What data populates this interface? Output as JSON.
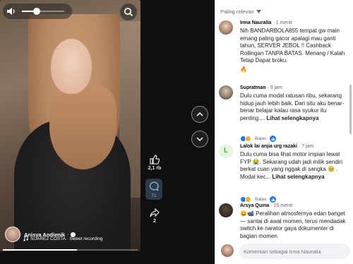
{
  "reel": {
    "author_name": "Anisya Andienik",
    "audio_label": "SUAREZ COSTA · Sweet recording",
    "volume_level": 0.35,
    "progress_level": 0.55,
    "likes_count": "2,1 rb",
    "comments_count": "71",
    "shares_count": "2"
  },
  "comments_panel": {
    "sort_label": "Paling relevan",
    "comments": [
      {
        "name": "Irma Nauralia",
        "time": "· 1 menit",
        "text": "Nih BANDARBOLA855 tempat gw main emang paling gacor apalagi mau ganti tahun, SERVER JEBOL !! Cashback Rollingan TANPA BATAS. Menang / Kalah Tetap Dapat broku.",
        "emoji": "🔥"
      },
      {
        "name": "Supratman",
        "time": "· 9 jam",
        "text": "Dulu cuma modal ratusan ribu, sekarang hidup jauh lebih baik. Dari situ aku benar-benar belajar kalau rasa syukur itu penting....",
        "more": "Lihat selengkapnya",
        "reply_label": "Balas"
      },
      {
        "name": "Lalok lai anjia urg razaki",
        "time": "· 7 jam",
        "avatar_letter": "L",
        "text": "Dulu cuma bisa lihat motor impian lewat FYP 😭. Sekarang udah jadi milik sendiri berkat cuan yang nggak di sangka 🥹 . Modal kec...",
        "more": "Lihat selengkapnya",
        "reply_label": "Balas"
      },
      {
        "name": "Arsya Quina",
        "time": "· 16 menit",
        "text": "😄📹 Peralihan atmosfernya edan banget — santai di awal momen, terus mendadak switch ke narator gaya dokumenter di bagian momen"
      }
    ],
    "composer_placeholder": "Komentari sebagai Irma Nauralia"
  },
  "colors": {
    "accent": "#1877f2",
    "panel_bg": "#ffffff",
    "reel_bg": "#0f0f10",
    "comment_box": "#2b3a46"
  }
}
